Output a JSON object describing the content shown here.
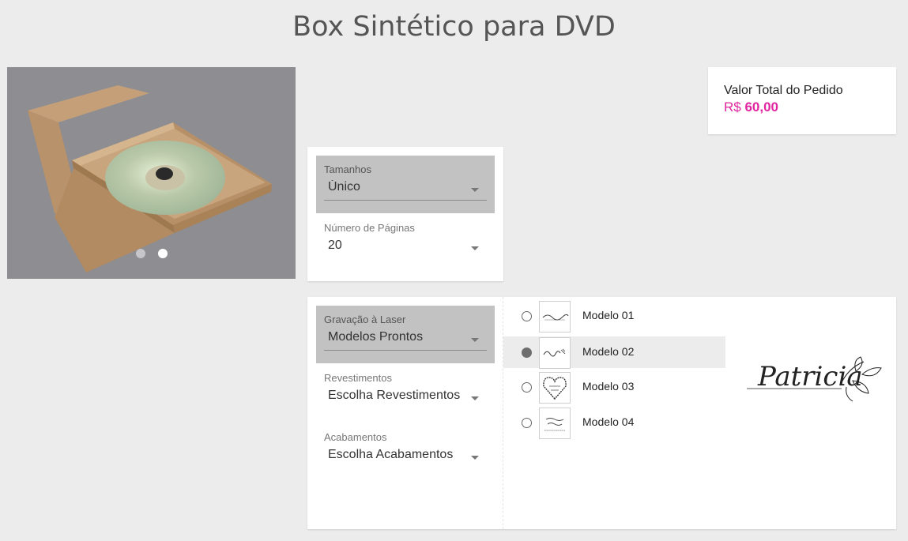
{
  "page": {
    "title": "Box Sintético para DVD"
  },
  "gallery": {
    "image": "dvd-box-photo",
    "dots": 2,
    "active_dot": 2
  },
  "order": {
    "total_label": "Valor Total do Pedido",
    "currency": "R$",
    "total_value": "60,00",
    "accent_color": "#e0259f"
  },
  "options": {
    "sizes": {
      "label": "Tamanhos",
      "value": "Único"
    },
    "pages": {
      "label": "Número de Páginas",
      "value": "20"
    },
    "laser": {
      "label": "Gravação à Laser",
      "value": "Modelos Prontos"
    },
    "coatings": {
      "label": "Revestimentos",
      "value": "Escolha Revestimentos"
    },
    "finishes": {
      "label": "Acabamentos",
      "value": "Escolha Acabamentos"
    }
  },
  "models": [
    {
      "label": "Modelo 01",
      "selected": false
    },
    {
      "label": "Modelo 02",
      "selected": true
    },
    {
      "label": "Modelo 03",
      "selected": false
    },
    {
      "label": "Modelo 04",
      "selected": false
    }
  ],
  "preview": {
    "name": "Patricia"
  }
}
